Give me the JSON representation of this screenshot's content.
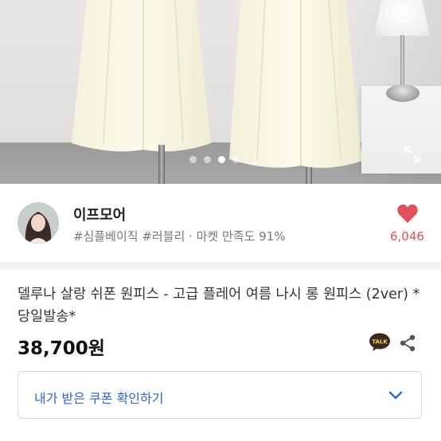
{
  "gallery": {
    "dots": [
      false,
      false,
      true,
      false
    ],
    "expand_icon": "expand-icon"
  },
  "seller": {
    "name": "이프모어",
    "tags": "#심플베이직 #러블리 · 마켓 만족도 91%",
    "likes": "6,046",
    "heart_color": "#e2505a"
  },
  "product": {
    "title": "델루나 살랑 쉬폰 원피스 - 고급 플레어 여름 나시 롱 원피스 (2ver) *당일발송*",
    "price": "38,700원",
    "talk_badge": "TALK"
  },
  "coupon": {
    "label": "내가 받은 쿠폰 확인하기",
    "accent": "#2f62d7"
  }
}
